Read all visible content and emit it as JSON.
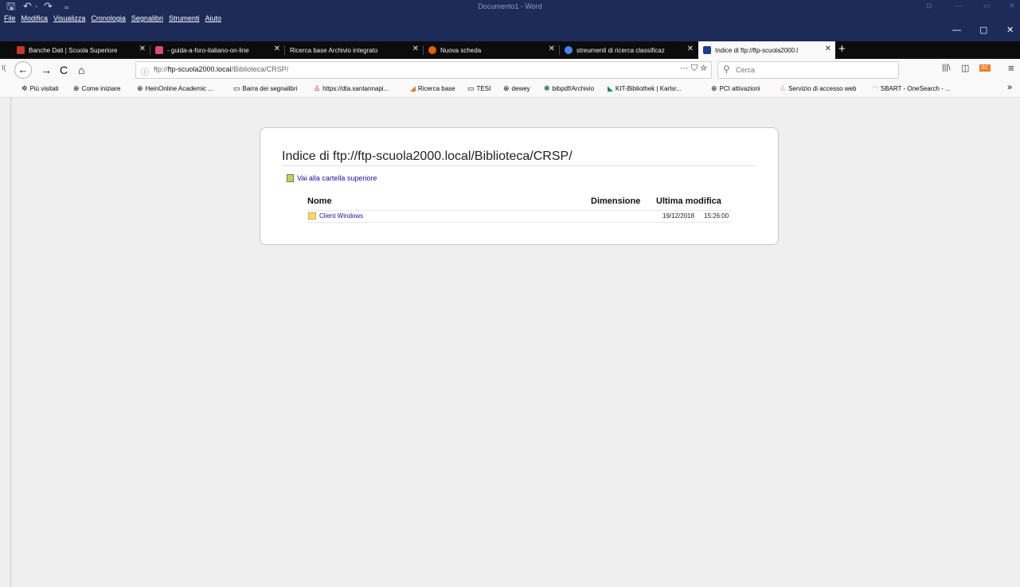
{
  "word": {
    "qa_save": "🖫",
    "qa_undo": "↶ ·",
    "qa_redo": "↷",
    "qa_more": "₌",
    "title": "Documento1 - Word",
    "faded_controls": [
      "⊡",
      "—",
      "▭",
      "✕"
    ]
  },
  "menu": [
    "File",
    "Modifica",
    "Visualizza",
    "Cronologia",
    "Segnalibri",
    "Strumenti",
    "Aiuto"
  ],
  "window_controls": {
    "minimize": "—",
    "restore": "▢",
    "close": "✕"
  },
  "tabs": [
    {
      "label": "Banche Dati | Scuola Superiore",
      "close": "✕",
      "favicon_color": "#c0392b",
      "active": false
    },
    {
      "label": "- guida-a-foro-italiano-on-line",
      "close": "✕",
      "favicon_color": "#d94f6a",
      "active": false
    },
    {
      "label": "Ricerca base Archivio integrato",
      "close": "✕",
      "favicon_color": "",
      "active": false
    },
    {
      "label": "Nuova scheda",
      "close": "✕",
      "favicon_color": "#e66000",
      "active": false
    },
    {
      "label": "streumenti di ricerca classificaz",
      "close": "✕",
      "favicon_color": "#4285f4",
      "active": false
    },
    {
      "label": "Indice di ftp://ftp-scuola2000.l",
      "close": "✕",
      "favicon_color": "#1f3a93",
      "active": true
    }
  ],
  "new_tab": "+",
  "nav": {
    "side_marker": "I(",
    "back": "←",
    "forward": "→",
    "reload": "C",
    "home": "⌂",
    "info_icon": "ⓘ",
    "url_prefix": "ftp://",
    "url_host": "ftp-scuola2000.local",
    "url_path": "/Biblioteca/CRSP/",
    "page_actions": "···  ⛉  ☆",
    "search_icon": "⚲",
    "search_placeholder": "Cerca",
    "library": "|||\\",
    "sidebar": "◫",
    "ext": "SC",
    "menu": "≡"
  },
  "bookmarks": [
    {
      "icon": "✲",
      "label": "Più visitati"
    },
    {
      "icon": "⊕",
      "label": "Come iniziare"
    },
    {
      "icon": "⊕",
      "label": "HeinOnline Academic ..."
    },
    {
      "icon": "▭",
      "label": "Barra dei segnalibri"
    },
    {
      "icon": "♙",
      "label": "https://dta.santannapi..."
    },
    {
      "icon": "◢",
      "label": "Ricerca base"
    },
    {
      "icon": "▭",
      "label": "TESI"
    },
    {
      "icon": "⊕",
      "label": "dewey"
    },
    {
      "icon": "✽",
      "label": "bibpdf/Archivio"
    },
    {
      "icon": "◣",
      "label": "KIT-Bibliothek | Karlsr..."
    },
    {
      "icon": "⊕",
      "label": "PCI attivazioni"
    },
    {
      "icon": "♙",
      "label": "Servizio di accesso web"
    },
    {
      "icon": "◠",
      "label": "SBART - OneSearch - ..."
    }
  ],
  "bookmarks_overflow": "»",
  "page": {
    "heading": "Indice di ftp://ftp-scuola2000.local/Biblioteca/CRSP/",
    "up_link": "Vai alla cartella superiore",
    "columns": {
      "name": "Nome",
      "size": "Dimensione",
      "modified": "Ultima modifica"
    },
    "entries": [
      {
        "name": "Client Windows",
        "size": "",
        "date": "19/12/2018",
        "time": "15:26:00"
      }
    ]
  }
}
